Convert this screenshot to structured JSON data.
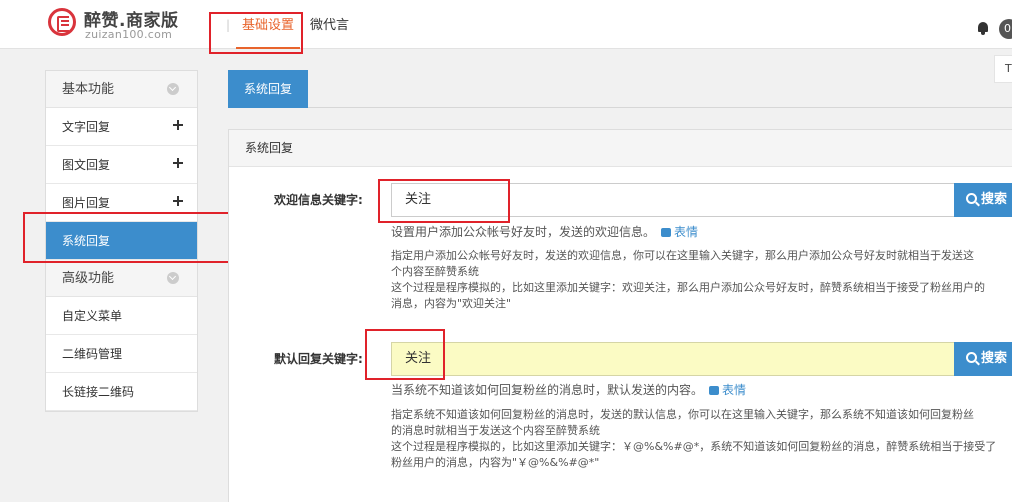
{
  "header": {
    "logo_title": "醉赞.商家版",
    "logo_sub": "zuizan100.com",
    "nav_separator": "|",
    "nav_tabs": [
      "基础设置",
      "微代言"
    ],
    "badge": "0"
  },
  "sidebar": {
    "group_basic": "基本功能",
    "basic_items": [
      "文字回复",
      "图文回复",
      "图片回复",
      "系统回复"
    ],
    "group_advanced": "高级功能",
    "advanced_items": [
      "自定义菜单",
      "二维码管理",
      "长链接二维码"
    ]
  },
  "main": {
    "tab": "系统回复",
    "right_tip": "T",
    "panel_title": "系统回复",
    "welcome": {
      "label": "欢迎信息关键字:",
      "value": "关注",
      "search": "搜索",
      "hint": "设置用户添加公众帐号好友时，发送的欢迎信息。",
      "emote": "表情",
      "desc": [
        "指定用户添加公众帐号好友时，发送的欢迎信息，你可以在这里输入关键字，那么用户添加公众号好友时就相当于发送这",
        "个内容至醉赞系统",
        "这个过程是程序模拟的，比如这里添加关键字：欢迎关注，那么用户添加公众号好友时，醉赞系统相当于接受了粉丝用户的",
        "消息，内容为\"欢迎关注\""
      ]
    },
    "default": {
      "label": "默认回复关键字:",
      "value": "关注",
      "search": "搜索",
      "hint": "当系统不知道该如何回复粉丝的消息时，默认发送的内容。",
      "emote": "表情",
      "desc": [
        "指定系统不知道该如何回复粉丝的消息时，发送的默认信息，你可以在这里输入关键字，那么系统不知道该如何回复粉丝",
        "的消息时就相当于发送这个内容至醉赞系统",
        "这个过程是程序模拟的，比如这里添加关键字：￥@%&%#@*，系统不知道该如何回复粉丝的消息，醉赞系统相当于接受了",
        "粉丝用户的消息，内容为\"￥@%&%#@*\""
      ]
    }
  }
}
